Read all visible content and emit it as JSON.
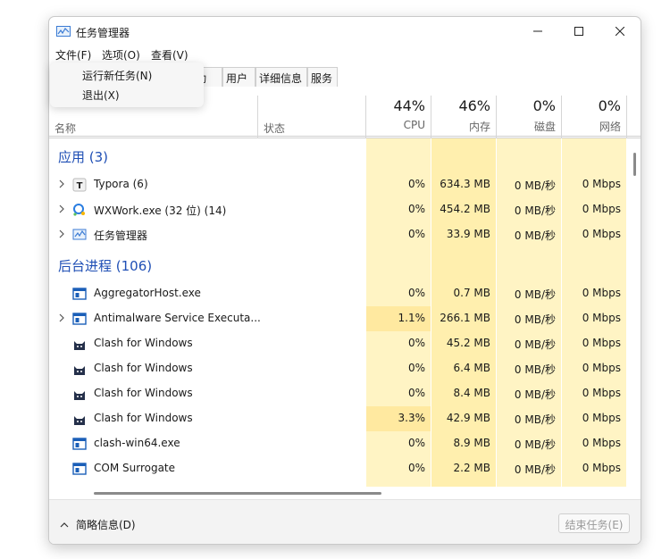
{
  "window": {
    "title": "任务管理器"
  },
  "menu": {
    "file": "文件(F)",
    "options": "选项(O)",
    "view": "查看(V)"
  },
  "dropdown": {
    "run_new_task": "运行新任务(N)",
    "exit": "退出(X)"
  },
  "tabs": {
    "startup": "动",
    "users": "用户",
    "details": "详细信息",
    "services": "服务"
  },
  "header": {
    "name": "名称",
    "status": "状态",
    "cpu": {
      "pct": "44%",
      "label": "CPU"
    },
    "mem": {
      "pct": "46%",
      "label": "内存"
    },
    "disk": {
      "pct": "0%",
      "label": "磁盘"
    },
    "net": {
      "pct": "0%",
      "label": "网络"
    }
  },
  "groups": {
    "apps": "应用 (3)",
    "background": "后台进程 (106)"
  },
  "rows": [
    {
      "name": "Typora (6)",
      "icon": "typora-icon",
      "expandable": true,
      "cpu": "0%",
      "mem": "634.3 MB",
      "disk": "0 MB/秒",
      "net": "0 Mbps"
    },
    {
      "name": "WXWork.exe (32 位) (14)",
      "icon": "wxwork-icon",
      "expandable": true,
      "cpu": "0%",
      "mem": "454.2 MB",
      "disk": "0 MB/秒",
      "net": "0 Mbps"
    },
    {
      "name": "任务管理器",
      "icon": "task-manager-icon",
      "expandable": true,
      "cpu": "0%",
      "mem": "33.9 MB",
      "disk": "0 MB/秒",
      "net": "0 Mbps"
    },
    {
      "name": "AggregatorHost.exe",
      "icon": "app-window-icon",
      "expandable": false,
      "cpu": "0%",
      "mem": "0.7 MB",
      "disk": "0 MB/秒",
      "net": "0 Mbps"
    },
    {
      "name": "Antimalware Service Executa...",
      "icon": "app-window-icon",
      "expandable": true,
      "cpu": "1.1%",
      "mem": "266.1 MB",
      "disk": "0 MB/秒",
      "net": "0 Mbps"
    },
    {
      "name": "Clash for Windows",
      "icon": "cat-icon",
      "expandable": false,
      "cpu": "0%",
      "mem": "45.2 MB",
      "disk": "0 MB/秒",
      "net": "0 Mbps"
    },
    {
      "name": "Clash for Windows",
      "icon": "cat-icon",
      "expandable": false,
      "cpu": "0%",
      "mem": "6.4 MB",
      "disk": "0 MB/秒",
      "net": "0 Mbps"
    },
    {
      "name": "Clash for Windows",
      "icon": "cat-icon",
      "expandable": false,
      "cpu": "0%",
      "mem": "8.4 MB",
      "disk": "0 MB/秒",
      "net": "0 Mbps"
    },
    {
      "name": "Clash for Windows",
      "icon": "cat-icon",
      "expandable": false,
      "cpu": "3.3%",
      "mem": "42.9 MB",
      "disk": "0 MB/秒",
      "net": "0 Mbps"
    },
    {
      "name": "clash-win64.exe",
      "icon": "app-window-icon",
      "expandable": false,
      "cpu": "0%",
      "mem": "8.9 MB",
      "disk": "0 MB/秒",
      "net": "0 Mbps"
    },
    {
      "name": "COM Surrogate",
      "icon": "app-window-icon",
      "expandable": false,
      "cpu": "0%",
      "mem": "2.2 MB",
      "disk": "0 MB/秒",
      "net": "0 Mbps"
    }
  ],
  "footer": {
    "fewer_details": "简略信息(D)",
    "end_task": "结束任务(E)"
  },
  "colors": {
    "accent": "#1f4fb5",
    "heat_light": "#fff4c4",
    "heat_medium": "#ffefae"
  }
}
